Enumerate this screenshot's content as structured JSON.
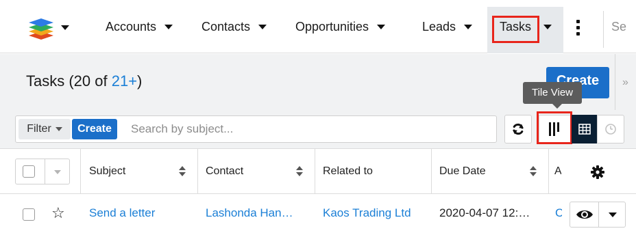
{
  "nav": {
    "logo_icon": "sugar-cube-logo",
    "items": [
      {
        "label": "Accounts"
      },
      {
        "label": "Contacts"
      },
      {
        "label": "Opportunities"
      },
      {
        "label": "Leads"
      },
      {
        "label": "Tasks"
      }
    ],
    "more_icon": "vertical-ellipsis-icon",
    "search_text": "Se"
  },
  "header": {
    "title_prefix": "Tasks (20 of ",
    "title_link": "21+",
    "title_suffix": ")",
    "create_label": "Create",
    "tooltip": "Tile View"
  },
  "filter": {
    "filter_label": "Filter",
    "create_label": "Create",
    "search_placeholder": "Search by subject...",
    "search_value": ""
  },
  "table": {
    "columns": [
      "Subject",
      "Contact",
      "Related to",
      "Due Date",
      "A"
    ],
    "rows": [
      {
        "subject": "Send a letter",
        "contact": "Lashonda Han…",
        "related_to": "Kaos Trading Ltd",
        "due_date": "2020-04-07 12:…",
        "assigned": "C"
      }
    ]
  },
  "colors": {
    "accent_blue": "#1b6fc9",
    "link_blue": "#1b7fd6",
    "highlight_red": "#e8251b",
    "dark_button": "#0a1f33",
    "header_bg": "#f1f2f3"
  }
}
